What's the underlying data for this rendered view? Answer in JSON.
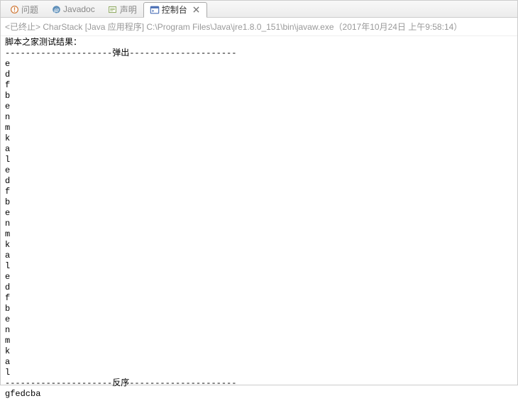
{
  "tabs": {
    "problems": {
      "label": "问题"
    },
    "javadoc": {
      "label": "Javadoc"
    },
    "declaration": {
      "label": "声明"
    },
    "console": {
      "label": "控制台"
    }
  },
  "terminated": "<已终止> CharStack [Java 应用程序] C:\\Program Files\\Java\\jre1.8.0_151\\bin\\javaw.exe（2017年10月24日 上午9:58:14）",
  "output": {
    "lines": [
      "脚本之家测试结果：",
      "---------------------弹出---------------------",
      "e",
      "d",
      "f",
      "b",
      "e",
      "n",
      "m",
      "k",
      "a",
      "l",
      "e",
      "d",
      "f",
      "b",
      "e",
      "n",
      "m",
      "k",
      "a",
      "l",
      "e",
      "d",
      "f",
      "b",
      "e",
      "n",
      "m",
      "k",
      "a",
      "l",
      "---------------------反序---------------------",
      "gfedcba"
    ]
  }
}
